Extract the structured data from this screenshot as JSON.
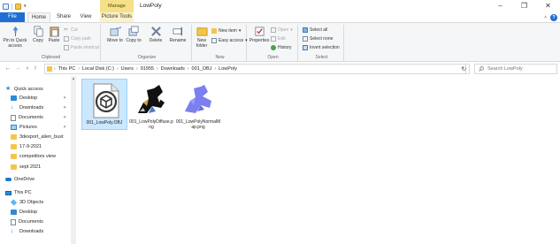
{
  "window": {
    "title": "LowPoly",
    "context_tab_group": "Manage",
    "controls": [
      "–",
      "❐",
      "✕"
    ]
  },
  "ribbon_tabs": [
    "File",
    "Home",
    "Share",
    "View",
    "Picture Tools"
  ],
  "ribbon": {
    "clipboard": {
      "label": "Clipboard",
      "pin": "Pin to Quick access",
      "copy": "Copy",
      "paste": "Paste",
      "cut": "Cut",
      "copy_path": "Copy path",
      "paste_shortcut": "Paste shortcut"
    },
    "organize": {
      "label": "Organize",
      "move_to": "Move to",
      "copy_to": "Copy to",
      "delete": "Delete",
      "rename": "Rename"
    },
    "new": {
      "label": "New",
      "new_folder": "New folder",
      "new_item": "New item",
      "easy_access": "Easy access"
    },
    "open": {
      "label": "Open",
      "properties": "Properties",
      "open": "Open",
      "edit": "Edit",
      "history": "History"
    },
    "select": {
      "label": "Select",
      "select_all": "Select all",
      "select_none": "Select none",
      "invert_selection": "Invert selection"
    }
  },
  "address": {
    "crumbs": [
      "This PC",
      "Local Disk (C:)",
      "Users",
      "91955",
      "Downloads",
      "001_OBJ",
      "LowPoly"
    ]
  },
  "search": {
    "placeholder": "Search LowPoly"
  },
  "nav_pane": {
    "items": [
      {
        "label": "Quick access",
        "icon": "star-icon",
        "pinned": false
      },
      {
        "label": "Desktop",
        "icon": "folder-blue-icon",
        "pinned": true
      },
      {
        "label": "Downloads",
        "icon": "download-icon",
        "pinned": true
      },
      {
        "label": "Documents",
        "icon": "document-icon",
        "pinned": true
      },
      {
        "label": "Pictures",
        "icon": "pictures-icon",
        "pinned": true
      },
      {
        "label": "3dexport_alien_bust",
        "icon": "folder-icon",
        "pinned": false
      },
      {
        "label": "17-9-2021",
        "icon": "folder-icon",
        "pinned": false
      },
      {
        "label": "competitors view",
        "icon": "folder-icon",
        "pinned": false
      },
      {
        "label": "sept 2021",
        "icon": "folder-icon",
        "pinned": false
      },
      {
        "label": "OneDrive",
        "icon": "cloud-icon",
        "pinned": false
      },
      {
        "label": "This PC",
        "icon": "computer-icon",
        "pinned": false
      },
      {
        "label": "3D Objects",
        "icon": "cube-icon",
        "pinned": false
      },
      {
        "label": "Desktop",
        "icon": "folder-blue-icon",
        "pinned": false
      },
      {
        "label": "Documents",
        "icon": "document-icon",
        "pinned": false
      },
      {
        "label": "Downloads",
        "icon": "download-icon",
        "pinned": false
      }
    ]
  },
  "files": [
    {
      "name": "001_LowPoly.OBJ",
      "icon": "obj-file-icon",
      "selected": true
    },
    {
      "name": "001_LowPolyDiffuse.png",
      "icon": "image-thumbnail",
      "selected": false
    },
    {
      "name": "001_LowPolyNormalMap.png",
      "icon": "image-thumbnail",
      "selected": false
    }
  ],
  "colors": {
    "file_tab": "#1e6ed4",
    "manage_context": "#f6e08a",
    "selection": "#cce8ff",
    "normal_map_blue": "#7b7ff0"
  }
}
